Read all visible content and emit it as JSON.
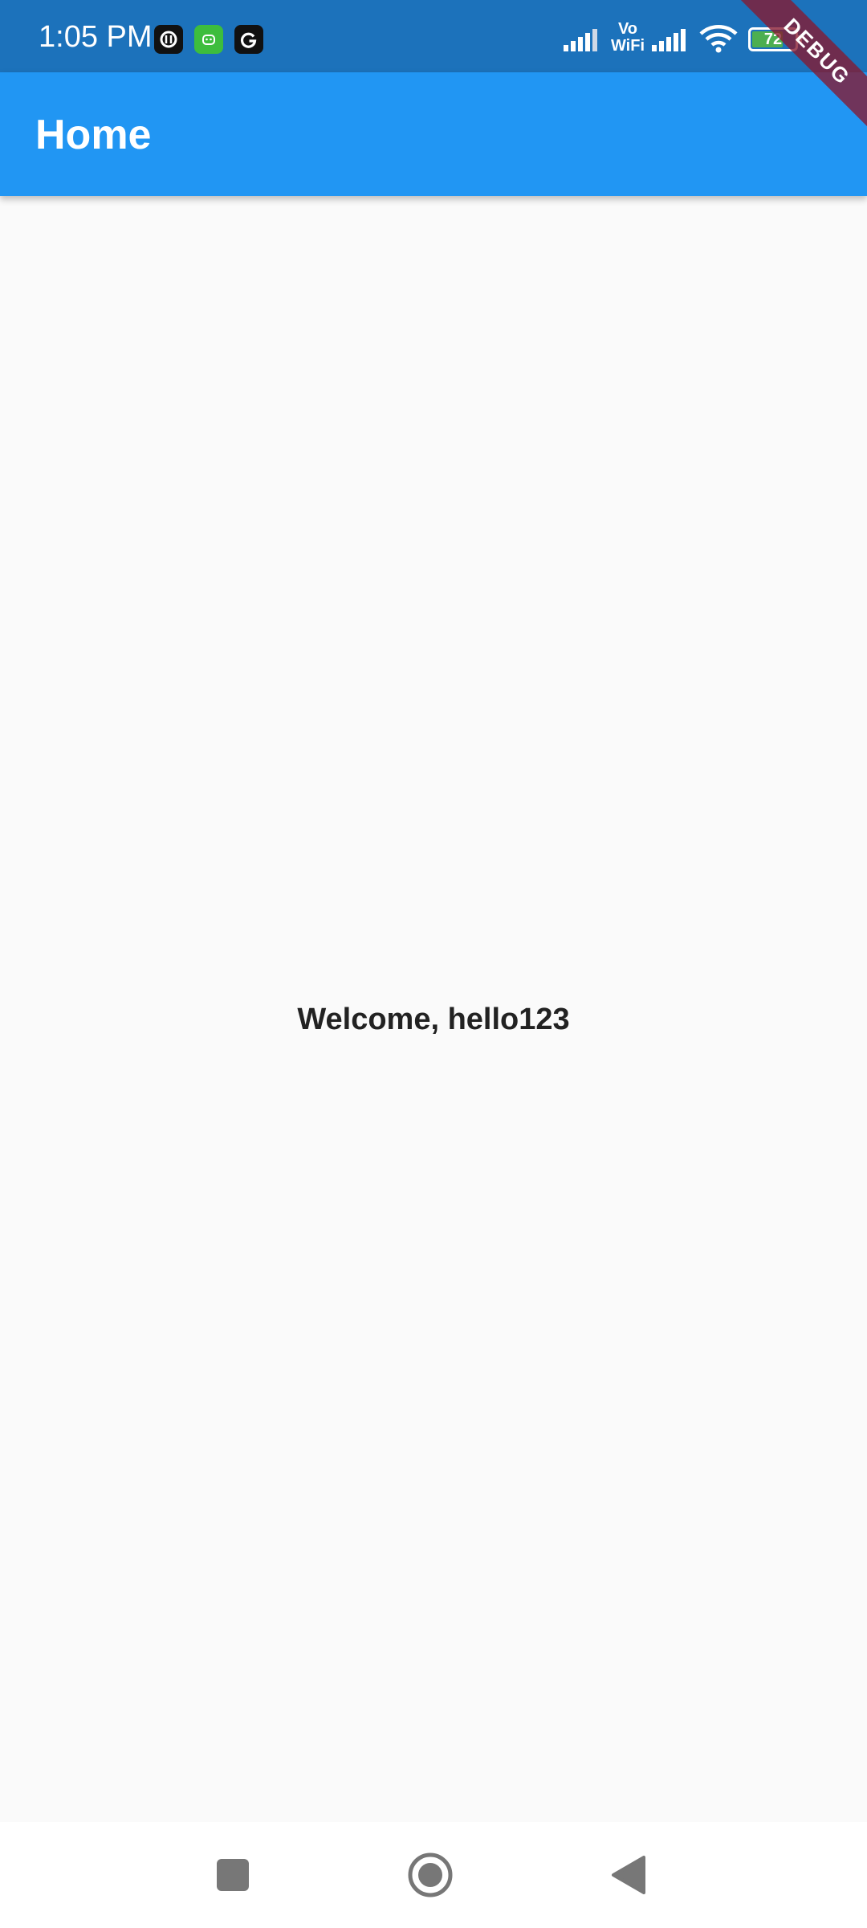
{
  "status_bar": {
    "time": "1:05 PM",
    "notification_icons": [
      "threads-icon",
      "android-app-icon",
      "google-icon"
    ],
    "vowifi_line1": "Vo",
    "vowifi_line2": "WiFi",
    "battery_level": "72",
    "colors": {
      "background": "#1c72bb",
      "battery_fill": "#4caf50"
    }
  },
  "app_bar": {
    "title": "Home",
    "color": "#2196f3"
  },
  "debug_banner": {
    "label": "DEBUG"
  },
  "main": {
    "welcome_message": "Welcome, hello123"
  },
  "nav_bar": {
    "buttons": [
      "recents-icon",
      "home-icon",
      "back-icon"
    ]
  }
}
